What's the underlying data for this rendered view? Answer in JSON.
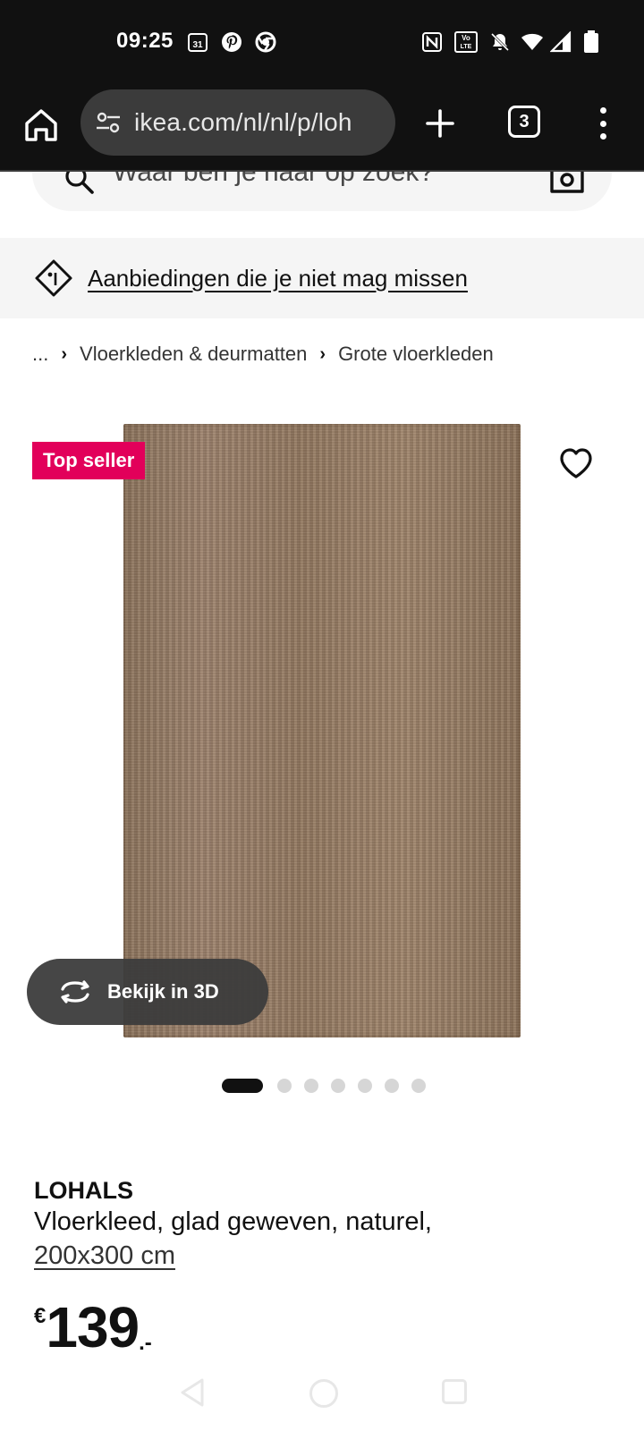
{
  "status_bar": {
    "time": "09:25",
    "calendar_day": "31",
    "volte_line1": "Vo",
    "volte_line2": "LTE"
  },
  "browser": {
    "url": "ikea.com/nl/nl/p/loh",
    "tab_count": "3"
  },
  "search": {
    "placeholder": "Waar ben je naar op zoek?"
  },
  "promo": {
    "link_text": "Aanbiedingen die je niet mag missen"
  },
  "breadcrumb": {
    "items": [
      "...",
      "Vloerkleden & deurmatten",
      "Grote vloerkleden"
    ],
    "separator": "›"
  },
  "product": {
    "badge": "Top seller",
    "view_3d_label": "Bekijk in 3D",
    "image_count": 7,
    "active_image": 0,
    "name": "LOHALS",
    "description": "Vloerkleed, glad geweven, naturel,",
    "size": "200x300 cm",
    "price": {
      "currency": "€",
      "integer": "139",
      "suffix": ".-"
    }
  },
  "colors": {
    "badge_bg": "#e2005a",
    "status_bar_bg": "#111111",
    "url_box_bg": "#3b3b3b",
    "promo_bg": "#f5f5f5"
  },
  "icons": {
    "status": [
      "calendar-icon",
      "pinterest-icon",
      "chrome-icon",
      "nfc-icon",
      "volte-icon",
      "bell-off-icon",
      "wifi-icon",
      "signal-icon",
      "battery-icon"
    ],
    "browser": [
      "home-icon",
      "tune-icon",
      "plus-icon",
      "tabs-icon",
      "more-vert-icon"
    ],
    "page": [
      "search-icon",
      "camera-icon",
      "tag-icon",
      "heart-icon",
      "rotate-3d-icon"
    ]
  }
}
